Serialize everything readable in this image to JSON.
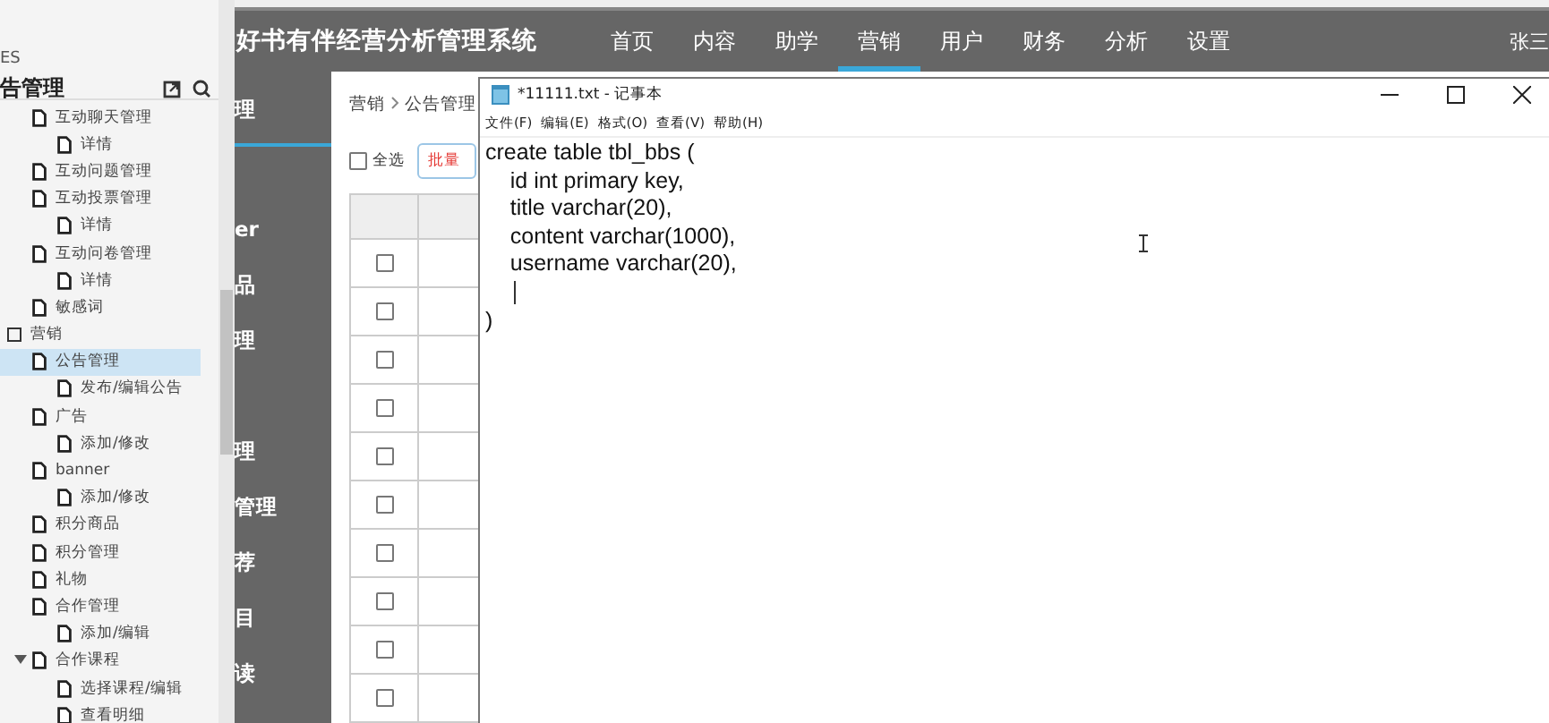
{
  "explorer": {
    "section": "ES",
    "title": "告管理",
    "tree": [
      {
        "children": [
          {
            "label": "互动聊天管理",
            "selected": false,
            "children": [
              {
                "label": "详情",
                "selected": false
              }
            ]
          },
          {
            "label": "互动问题管理",
            "selected": false
          },
          {
            "label": "互动投票管理",
            "selected": false,
            "children": [
              {
                "label": "详情",
                "selected": false
              }
            ]
          },
          {
            "label": "互动问卷管理",
            "selected": false,
            "children": [
              {
                "label": "详情",
                "selected": false
              }
            ]
          },
          {
            "label": "敏感词",
            "selected": false
          }
        ]
      },
      {
        "label": "营销",
        "selected": false,
        "folder": true,
        "children": [
          {
            "label": "公告管理",
            "selected": true,
            "children": [
              {
                "label": "发布/编辑公告",
                "selected": false
              }
            ]
          },
          {
            "label": "广告",
            "selected": false,
            "children": [
              {
                "label": "添加/修改",
                "selected": false
              }
            ]
          },
          {
            "label": "banner",
            "selected": false,
            "children": [
              {
                "label": "添加/修改",
                "selected": false
              }
            ]
          },
          {
            "label": "积分商品",
            "selected": false
          },
          {
            "label": "积分管理",
            "selected": false
          },
          {
            "label": "礼物",
            "selected": false
          },
          {
            "label": "合作管理",
            "selected": false,
            "children": [
              {
                "label": "添加/编辑",
                "selected": false
              }
            ]
          },
          {
            "label": "合作课程",
            "selected": false,
            "expanded": true,
            "children": [
              {
                "label": "选择课程/编辑",
                "selected": false
              },
              {
                "label": "查看明细",
                "selected": false
              }
            ]
          }
        ]
      }
    ]
  },
  "app": {
    "title": "好书有伴经营分析管理系统",
    "nav": [
      {
        "label": "首页",
        "selected": false
      },
      {
        "label": "内容",
        "selected": false
      },
      {
        "label": "助学",
        "selected": false
      },
      {
        "label": "营销",
        "selected": true
      },
      {
        "label": "用户",
        "selected": false
      },
      {
        "label": "财务",
        "selected": false
      },
      {
        "label": "分析",
        "selected": false
      },
      {
        "label": "设置",
        "selected": false
      }
    ],
    "user": "张三",
    "sidebar": [
      {
        "label": "理",
        "selected": true
      },
      {
        "label": "er",
        "selected": false
      },
      {
        "label": "品",
        "selected": false
      },
      {
        "label": "理",
        "selected": false
      },
      {
        "label": "理",
        "selected": false
      },
      {
        "label": "管理",
        "selected": false
      },
      {
        "label": "荐",
        "selected": false
      },
      {
        "label": "目",
        "selected": false
      },
      {
        "label": "读",
        "selected": false
      }
    ],
    "breadcrumb": [
      "营销",
      "公告管理"
    ],
    "select_all": {
      "label": "全选",
      "checked": false
    },
    "batch_button": "批量",
    "rows": [
      {
        "checked": false
      },
      {
        "checked": false
      },
      {
        "checked": false
      },
      {
        "checked": false
      },
      {
        "checked": false
      },
      {
        "checked": false
      },
      {
        "checked": false
      },
      {
        "checked": false
      },
      {
        "checked": false
      },
      {
        "checked": false
      }
    ]
  },
  "notepad": {
    "title": "*11111.txt - 记事本",
    "menu": [
      "文件(F)",
      "编辑(E)",
      "格式(O)",
      "查看(V)",
      "帮助(H)"
    ],
    "lines": [
      {
        "kind": "text",
        "text": "create table tbl_bbs ("
      },
      {
        "kind": "text",
        "text": "    id int primary key,"
      },
      {
        "kind": "text",
        "text": "    title varchar(20),"
      },
      {
        "kind": "text",
        "text": "    content varchar(1000),"
      },
      {
        "kind": "text",
        "text": "    username varchar(20),"
      },
      {
        "kind": "caret"
      },
      {
        "kind": "text",
        "text": ")"
      }
    ]
  }
}
